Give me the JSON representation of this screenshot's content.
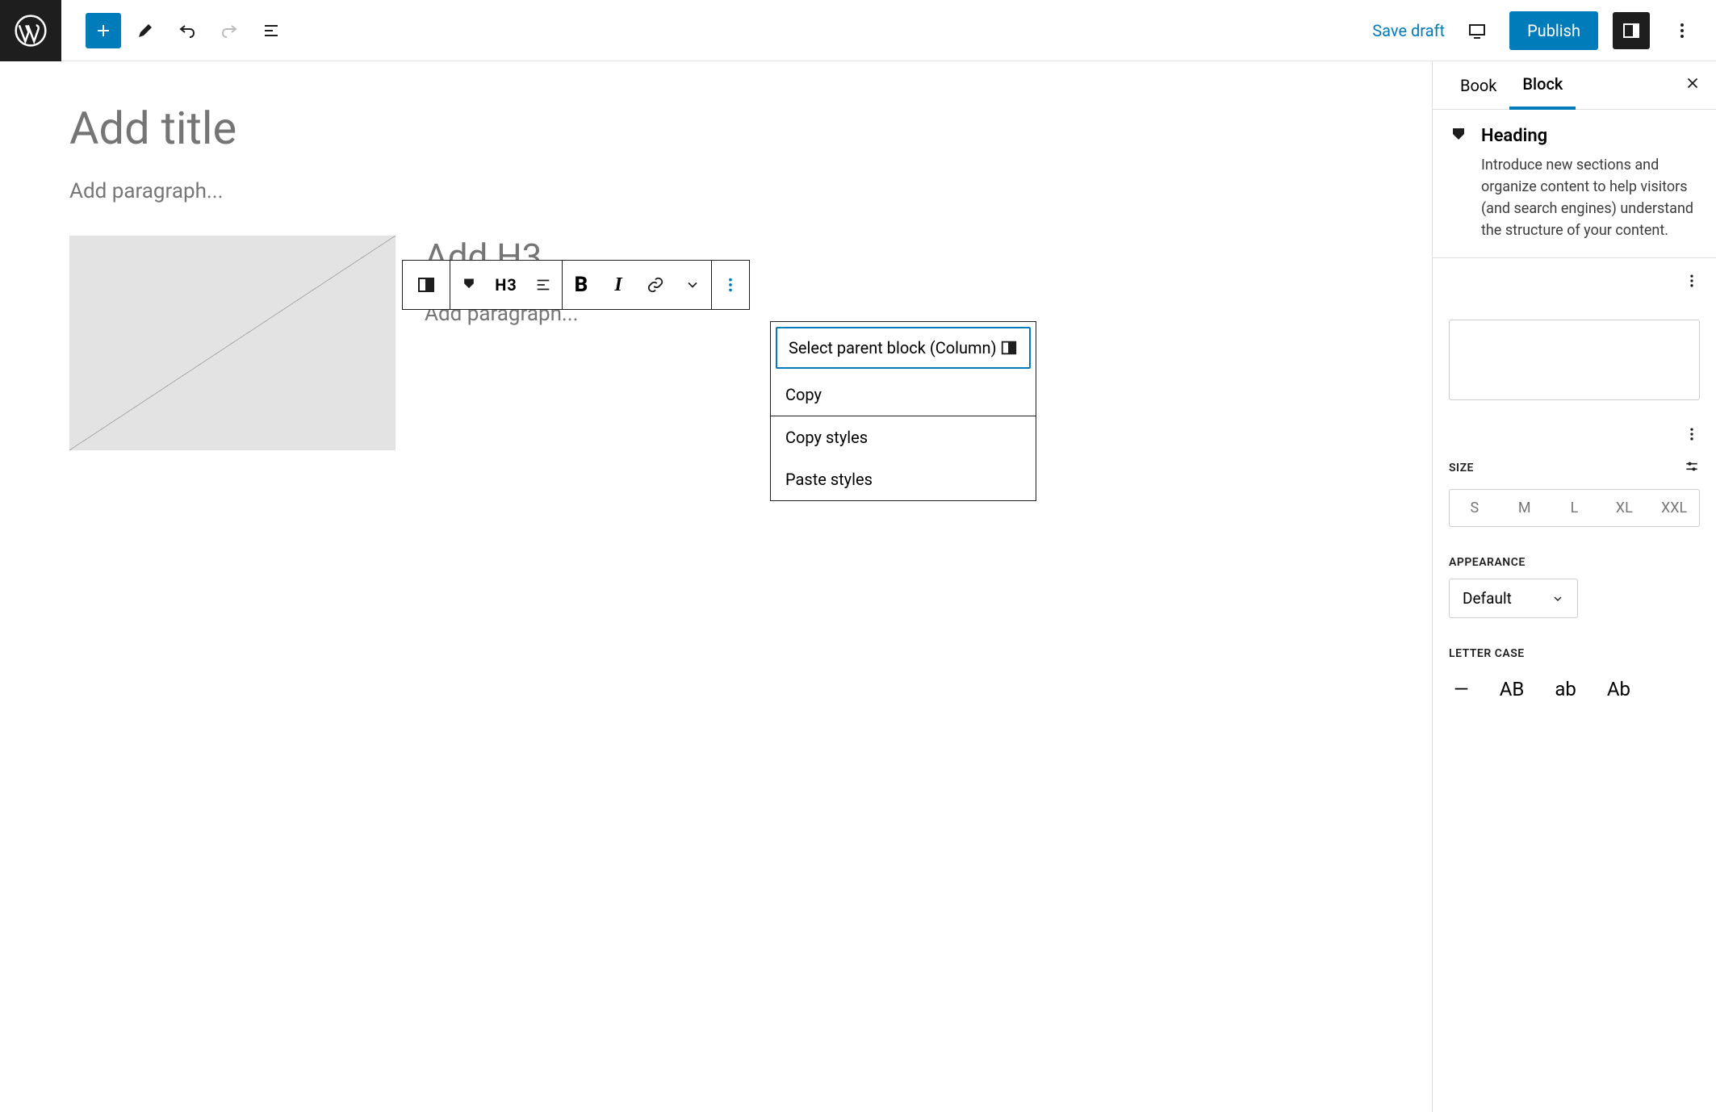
{
  "topbar": {
    "save_draft": "Save draft",
    "publish": "Publish"
  },
  "editor": {
    "title_placeholder": "Add title",
    "paragraph_placeholder": "Add paragraph...",
    "h3_placeholder": "Add H3...",
    "col_paragraph_placeholder": "Add paragraph..."
  },
  "block_toolbar": {
    "heading_level": "H3"
  },
  "dropdown": {
    "select_parent": "Select parent block (Column)",
    "copy": "Copy",
    "copy_styles": "Copy styles",
    "paste_styles": "Paste styles"
  },
  "sidebar": {
    "tabs": {
      "book": "Book",
      "block": "Block"
    },
    "block_info": {
      "title": "Heading",
      "description": "Introduce new sections and organize content to help visitors (and search engines) understand the structure of your content."
    },
    "size": {
      "label": "SIZE",
      "options": [
        "S",
        "M",
        "L",
        "XL",
        "XXL"
      ]
    },
    "appearance": {
      "label": "APPEARANCE",
      "value": "Default"
    },
    "lettercase": {
      "label": "LETTER CASE",
      "options": [
        "—",
        "AB",
        "ab",
        "Ab"
      ]
    }
  }
}
